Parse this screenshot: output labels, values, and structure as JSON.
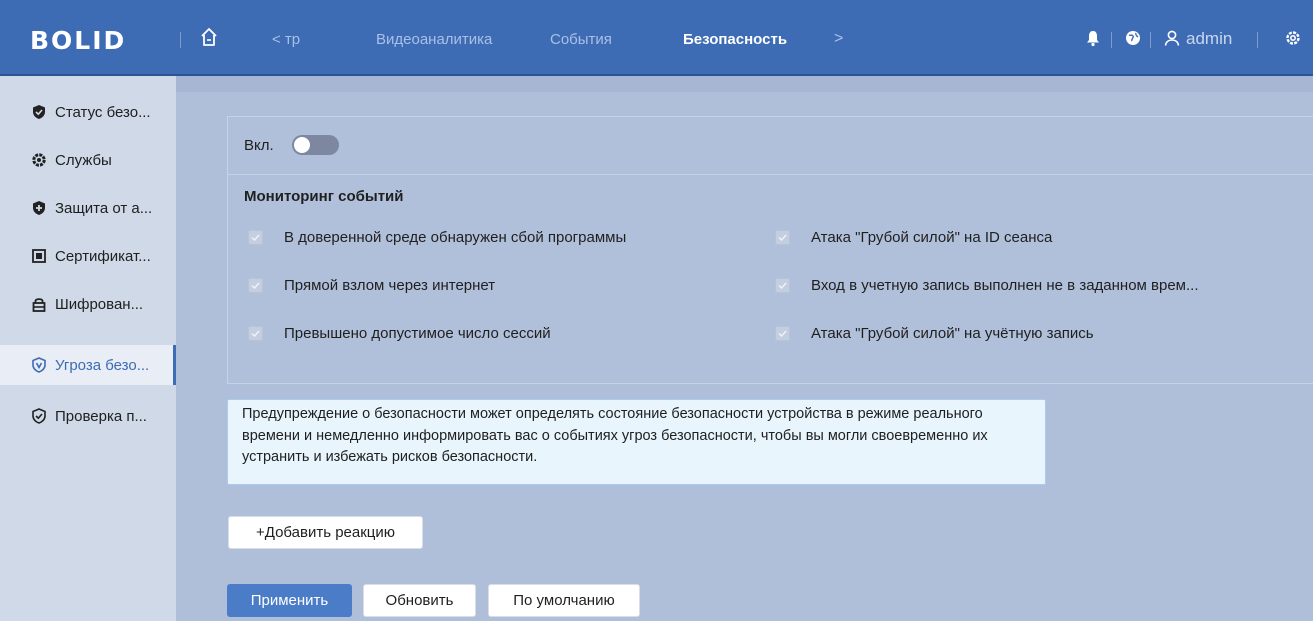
{
  "header": {
    "logo": "BOLID",
    "nav": {
      "prev_label": "< тр",
      "items": [
        "Видеоаналитика",
        "События",
        "Безопасность"
      ],
      "next_label": ">"
    },
    "user": "admin"
  },
  "sidebar": {
    "items": [
      {
        "label": "Статус безо...",
        "icon": "shield-check-icon"
      },
      {
        "label": "Службы",
        "icon": "gear-icon"
      },
      {
        "label": "Защита от а...",
        "icon": "shield-plus-icon"
      },
      {
        "label": "Сертификат...",
        "icon": "certificate-icon"
      },
      {
        "label": "Шифрован...",
        "icon": "lock-icon"
      },
      {
        "label": "Угроза безо...",
        "icon": "shield-alert-icon"
      },
      {
        "label": "Проверка п...",
        "icon": "shield-check-outline-icon"
      }
    ],
    "active_index": 5
  },
  "main": {
    "toggle_label": "Вкл.",
    "toggle_on": false,
    "section_title": "Мониторинг событий",
    "events": [
      {
        "label": "В доверенной среде обнаружен сбой программы",
        "checked": true
      },
      {
        "label": "Атака \"Грубой силой\" на ID сеанса",
        "checked": true
      },
      {
        "label": "Прямой взлом через интернет",
        "checked": true
      },
      {
        "label": "Вход в учетную запись выполнен не в заданном врем...",
        "checked": true
      },
      {
        "label": "Превышено допустимое число сессий",
        "checked": true
      },
      {
        "label": "Атака \"Грубой силой\" на учётную запись",
        "checked": true
      }
    ],
    "info_text": "Предупреждение о безопасности может определять состояние безопасности устройства в режиме реального времени и немедленно информировать вас о событиях угроз безопасности, чтобы вы могли своевременно их устранить и избежать рисков безопасности.",
    "add_reaction_label": "+Добавить реакцию",
    "buttons": {
      "apply": "Применить",
      "refresh": "Обновить",
      "default": "По умолчанию"
    }
  },
  "colors": {
    "header_bg": "#3d6cb5",
    "accent": "#3d6cb5",
    "primary_button": "#4b7cc8",
    "info_bg": "#e8f5fd"
  }
}
